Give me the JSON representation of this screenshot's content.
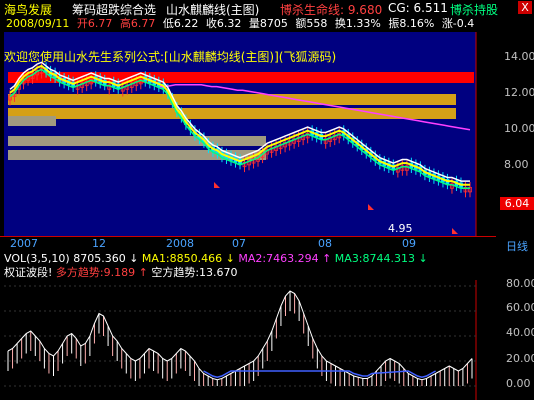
{
  "title": {
    "stock_name": "海鸟发展",
    "menu1": "筹码超跌综合选",
    "menu2": "山水麒麟线(主图)",
    "life_label": "博杀生命线: 9.680",
    "cg_label": "CG: 6.511",
    "hold_label": "博杀持股",
    "close_glyph": "X"
  },
  "ohlc": {
    "date": "2008/09/11",
    "open": "开6.77",
    "high": "高6.77",
    "low": "低6.22",
    "close": "收6.32",
    "volume": "量8705",
    "amount": "额558",
    "change": "换1.33%",
    "amplitude": "振8.16%",
    "rise": "涨-0.4"
  },
  "banner": "欢迎您使用山水先生系列公式:[山水麒麟均线(主图)](飞狐源码)",
  "price_axis": [
    "14.00",
    "12.00",
    "10.00",
    "8.00"
  ],
  "current_price": "6.04",
  "low_marker": "4.95",
  "dates": [
    "2007",
    "12",
    "2008",
    "07",
    "08",
    "09"
  ],
  "period_button": "日线",
  "vol_row": {
    "label": "VOL(3,5,10)",
    "vol": "8705.360",
    "ma1": "MA1:8850.466",
    "ma2": "MA2:7463.294",
    "ma3": "MA3:8744.313"
  },
  "sig_row": {
    "label": "权证波段!",
    "bull": "多方趋势:9.189",
    "bear": "空方趋势:13.670"
  },
  "osc_axis": [
    "80.00",
    "60.00",
    "40.00",
    "20.00",
    "0.00"
  ],
  "colors": {
    "up": "#ff3030",
    "down": "#00e0ff",
    "ma_yellow": "#ffff00",
    "ma_white": "#ffffff",
    "ma_magenta": "#ff40ff",
    "ma_green": "#00ff80",
    "band_red": "#ff0000",
    "band_gold": "#d4a017",
    "band_gray": "#a09a80",
    "chart_bg": "#000080"
  },
  "series": {
    "price_close": [
      11.4,
      11.6,
      12.0,
      12.3,
      12.5,
      12.6,
      12.8,
      12.9,
      12.7,
      12.5,
      12.4,
      12.2,
      12.1,
      12.0,
      11.9,
      12.0,
      12.1,
      12.2,
      12.3,
      12.2,
      12.1,
      12.0,
      12.0,
      11.9,
      11.8,
      11.9,
      12.0,
      12.1,
      12.2,
      12.3,
      12.2,
      12.1,
      12.0,
      11.9,
      11.8,
      11.5,
      11.0,
      10.5,
      10.2,
      9.8,
      9.5,
      9.2,
      9.0,
      8.8,
      8.5,
      8.3,
      8.2,
      8.0,
      7.9,
      7.8,
      7.7,
      7.6,
      7.7,
      7.8,
      7.9,
      8.0,
      8.2,
      8.4,
      8.5,
      8.6,
      8.7,
      8.8,
      8.9,
      9.0,
      9.1,
      9.2,
      9.3,
      9.2,
      9.1,
      9.0,
      9.0,
      9.1,
      9.2,
      9.3,
      9.2,
      9.0,
      8.8,
      8.6,
      8.4,
      8.2,
      8.0,
      7.8,
      7.6,
      7.5,
      7.4,
      7.3,
      7.4,
      7.5,
      7.5,
      7.4,
      7.3,
      7.2,
      7.0,
      6.9,
      6.8,
      6.7,
      6.6,
      6.5,
      6.5,
      6.4,
      6.3,
      6.3,
      6.3
    ],
    "magenta_ma": [
      11.9,
      11.9,
      11.95,
      12.0,
      12.0,
      12.0,
      12.0,
      12.0,
      12.0,
      11.95,
      11.9,
      11.9,
      11.85,
      11.8,
      11.75,
      11.7,
      11.7,
      11.65,
      11.6,
      11.55,
      11.5,
      11.45,
      11.4,
      11.35,
      11.3,
      11.25,
      11.2,
      11.15,
      11.1,
      11.05,
      11.0,
      10.95,
      10.9,
      10.85,
      10.8,
      10.75,
      10.7,
      10.65,
      10.6,
      10.55,
      10.5,
      10.45,
      10.4,
      10.35,
      10.3,
      10.25,
      10.2,
      10.15,
      10.1,
      10.05,
      10.0,
      9.95,
      9.9,
      9.85,
      9.8,
      9.75,
      9.7,
      9.65,
      9.6,
      9.55,
      9.5
    ]
  },
  "osc": [
    28,
    30,
    34,
    38,
    42,
    44,
    40,
    36,
    30,
    26,
    24,
    28,
    34,
    40,
    42,
    38,
    32,
    34,
    40,
    50,
    58,
    56,
    48,
    40,
    36,
    30,
    26,
    22,
    20,
    22,
    26,
    30,
    28,
    26,
    22,
    20,
    22,
    26,
    30,
    28,
    24,
    20,
    14,
    10,
    8,
    6,
    5,
    6,
    8,
    10,
    12,
    14,
    16,
    18,
    20,
    24,
    30,
    36,
    44,
    54,
    64,
    72,
    76,
    74,
    68,
    58,
    48,
    38,
    30,
    24,
    20,
    18,
    16,
    14,
    12,
    10,
    8,
    7,
    6,
    6,
    8,
    12,
    16,
    20,
    22,
    20,
    18,
    14,
    10,
    8,
    6,
    5,
    6,
    8,
    10,
    12,
    14,
    16,
    14,
    12,
    14,
    18,
    22
  ]
}
